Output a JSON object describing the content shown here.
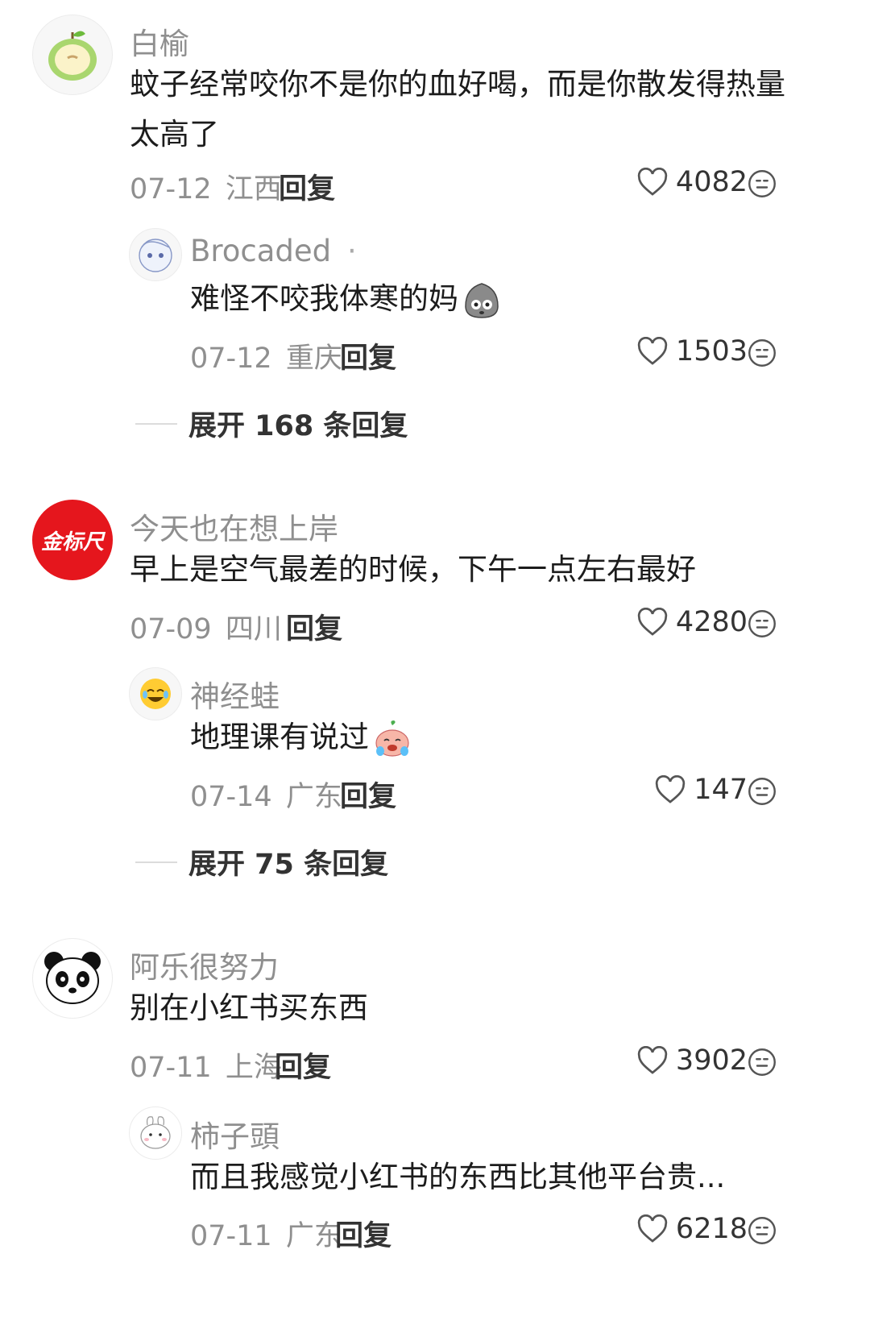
{
  "comments": [
    {
      "user": "白榆",
      "text": "蚊子经常咬你不是你的血好喝，而是你散发得热量太高了",
      "date": "07-12",
      "location": "江西",
      "reply_label": "回复",
      "likes": "4082",
      "avatar_icon": "green-apple-icon",
      "sub": {
        "user": "Brocaded",
        "user_suffix": "·",
        "text": "难怪不咬我体寒的妈",
        "emoji_icon": "gray-scared-sticker-icon",
        "date": "07-12",
        "location": "重庆",
        "reply_label": "回复",
        "likes": "1503"
      },
      "expand_label": "展开 168 条回复"
    },
    {
      "user": "今天也在想上岸",
      "text": "早上是空气最差的时候，下午一点左右最好",
      "date": "07-09",
      "location": "四川",
      "reply_label": "回复",
      "likes": "4280",
      "avatar_icon": "red-logo-avatar",
      "avatar_text": "金标尺",
      "sub": {
        "user": "神经蛙",
        "text": "地理课有说过",
        "emoji_icon": "crying-peach-sticker-icon",
        "date": "07-14",
        "location": "广东",
        "reply_label": "回复",
        "likes": "147"
      },
      "expand_label": "展开 75 条回复"
    },
    {
      "user": "阿乐很努力",
      "text": "别在小红书买东西",
      "date": "07-11",
      "location": "上海",
      "reply_label": "回复",
      "likes": "3902",
      "avatar_icon": "panda-avatar",
      "sub": {
        "user": "柿子頭",
        "text": "而且我感觉小红书的东西比其他平台贵...",
        "date": "07-11",
        "location": "广东",
        "reply_label": "回复",
        "likes": "6218"
      }
    }
  ],
  "colors": {
    "muted": "#8f8f8f",
    "text": "#1c1c1c",
    "avatar_red": "#e5161d"
  }
}
